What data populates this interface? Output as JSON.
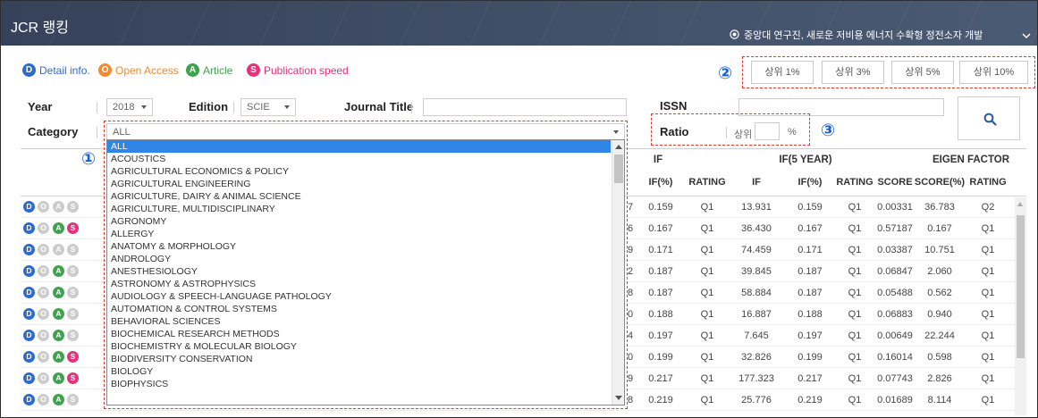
{
  "header": {
    "title": "JCR 랭킹",
    "news": "중앙대 연구진, 새로운 저비용 에너지 수확형 정전소자 개발"
  },
  "legend": [
    {
      "letter": "D",
      "label": "Detail info.",
      "color": "#2f6ad1",
      "icon": "detail-info-badge"
    },
    {
      "letter": "O",
      "label": "Open Access",
      "color": "#f28a2e",
      "icon": "open-access-badge"
    },
    {
      "letter": "A",
      "label": "Article",
      "color": "#3fa34d",
      "icon": "article-badge"
    },
    {
      "letter": "S",
      "label": "Publication speed",
      "color": "#e2337b",
      "icon": "publication-speed-badge"
    }
  ],
  "annotations": {
    "one": "①",
    "two": "②",
    "three": "③"
  },
  "top_buttons": [
    "상위 1%",
    "상위 3%",
    "상위 5%",
    "상위 10%"
  ],
  "filters": {
    "year": {
      "label": "Year",
      "value": "2018"
    },
    "edition": {
      "label": "Edition",
      "value": "SCIE"
    },
    "journal_title": {
      "label": "Journal Title",
      "value": ""
    },
    "issn": {
      "label": "ISSN",
      "value": ""
    },
    "ratio": {
      "label": "Ratio",
      "prefix": "상위",
      "value": "",
      "suffix": "%"
    },
    "category": {
      "label": "Category",
      "value": "ALL",
      "options": [
        "ALL",
        "ACOUSTICS",
        "AGRICULTURAL ECONOMICS & POLICY",
        "AGRICULTURAL ENGINEERING",
        "AGRICULTURE, DAIRY & ANIMAL SCIENCE",
        "AGRICULTURE, MULTIDISCIPLINARY",
        "AGRONOMY",
        "ALLERGY",
        "ANATOMY & MORPHOLOGY",
        "ANDROLOGY",
        "ANESTHESIOLOGY",
        "ASTRONOMY & ASTROPHYSICS",
        "AUDIOLOGY & SPEECH-LANGUAGE PATHOLOGY",
        "AUTOMATION & CONTROL SYSTEMS",
        "BEHAVIORAL SCIENCES",
        "BIOCHEMICAL RESEARCH METHODS",
        "BIOCHEMISTRY & MOLECULAR BIOLOGY",
        "BIODIVERSITY CONSERVATION",
        "BIOLOGY",
        "BIOPHYSICS"
      ]
    }
  },
  "table": {
    "group_headers": [
      "IF",
      "IF(5 YEAR)",
      "EIGEN FACTOR"
    ],
    "columns": [
      "IF(%)",
      "RATING",
      "IF",
      "IF(%)",
      "RATING",
      "SCORE",
      "SCORE(%)",
      "RATING"
    ],
    "rows": [
      {
        "flags": [
          true,
          false,
          false,
          false
        ],
        "clipped": "7",
        "cells": [
          "0.159",
          "Q1",
          "13.931",
          "0.159",
          "Q1",
          "0.00331",
          "36.783",
          "Q2"
        ]
      },
      {
        "flags": [
          true,
          false,
          true,
          true
        ],
        "clipped": "6",
        "cells": [
          "0.167",
          "Q1",
          "36.430",
          "0.167",
          "Q1",
          "0.57187",
          "0.167",
          "Q1"
        ]
      },
      {
        "flags": [
          true,
          false,
          false,
          false
        ],
        "clipped": "9",
        "cells": [
          "0.171",
          "Q1",
          "74.459",
          "0.171",
          "Q1",
          "0.03387",
          "10.751",
          "Q1"
        ]
      },
      {
        "flags": [
          true,
          false,
          true,
          false
        ],
        "clipped": "2",
        "cells": [
          "0.187",
          "Q1",
          "39.845",
          "0.187",
          "Q1",
          "0.06847",
          "2.060",
          "Q1"
        ]
      },
      {
        "flags": [
          true,
          false,
          true,
          false
        ],
        "clipped": "8",
        "cells": [
          "0.187",
          "Q1",
          "58.884",
          "0.187",
          "Q1",
          "0.05488",
          "0.562",
          "Q1"
        ]
      },
      {
        "flags": [
          true,
          false,
          true,
          false
        ],
        "clipped": "0",
        "cells": [
          "0.188",
          "Q1",
          "16.887",
          "0.188",
          "Q1",
          "0.06883",
          "0.940",
          "Q1"
        ]
      },
      {
        "flags": [
          true,
          false,
          true,
          false
        ],
        "clipped": "4",
        "cells": [
          "0.197",
          "Q1",
          "7.645",
          "0.197",
          "Q1",
          "0.00649",
          "22.244",
          "Q1"
        ]
      },
      {
        "flags": [
          true,
          false,
          true,
          true
        ],
        "clipped": "0",
        "cells": [
          "0.199",
          "Q1",
          "32.826",
          "0.199",
          "Q1",
          "0.16014",
          "0.598",
          "Q1"
        ]
      },
      {
        "flags": [
          true,
          false,
          true,
          true
        ],
        "clipped": "9",
        "cells": [
          "0.217",
          "Q1",
          "177.323",
          "0.217",
          "Q1",
          "0.07743",
          "2.826",
          "Q1"
        ]
      },
      {
        "flags": [
          true,
          false,
          true,
          false
        ],
        "clipped": "8",
        "cells": [
          "0.219",
          "Q1",
          "25.776",
          "0.219",
          "Q1",
          "0.01689",
          "8.114",
          "Q1"
        ]
      }
    ]
  },
  "icons": {
    "news": "notice-icon",
    "header_expand": "chevron-down-icon",
    "search": "search-icon",
    "select_arrow": "caret-down-icon",
    "scroll_up": "scroll-up-arrow-icon",
    "scroll_down": "scroll-down-arrow-icon"
  },
  "colors": {
    "header_bg_start": "#36425a",
    "header_bg_end": "#4b5a73",
    "annotation": "#1b5fd4",
    "highlight_box": "#e53935",
    "selected_option": "#2f86e8",
    "icon_inactive": "#cccccc"
  }
}
